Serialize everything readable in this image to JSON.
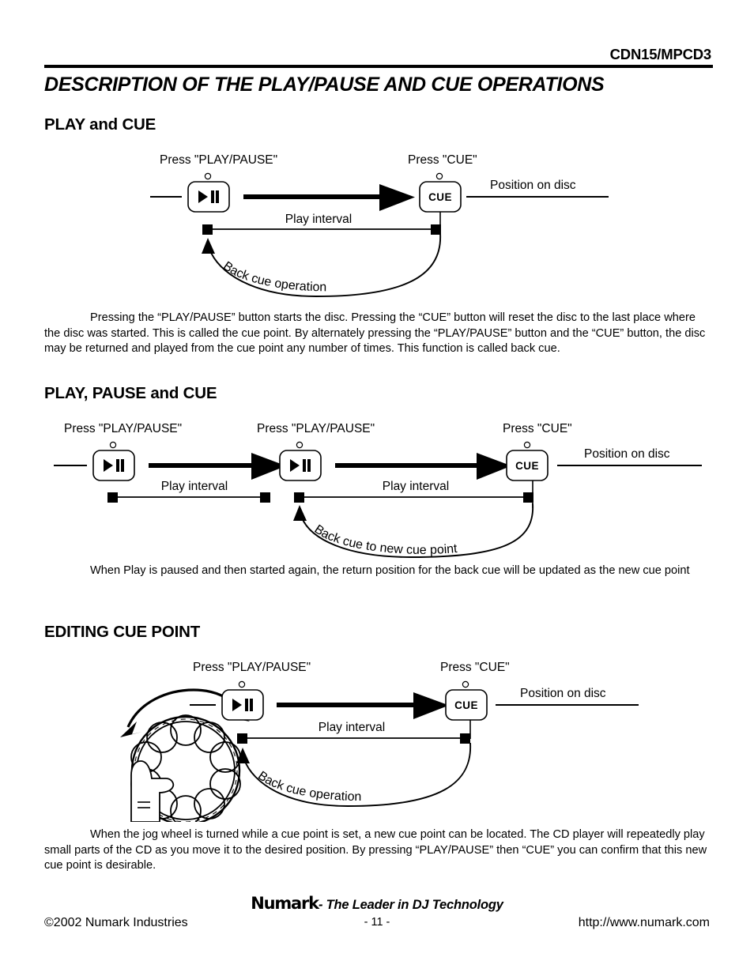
{
  "header": {
    "model": "CDN15/MPCD3"
  },
  "doc_title": "DESCRIPTION OF THE PLAY/PAUSE AND CUE OPERATIONS",
  "sections": [
    {
      "heading": "PLAY and CUE",
      "diagram": {
        "press_play_pause": "Press \"PLAY/PAUSE\"",
        "press_cue": "Press \"CUE\"",
        "position_on_disc": "Position on disc",
        "play_interval": "Play interval",
        "back_cue": "Back cue operation",
        "play_button_label": "▶❙❙",
        "cue_button_label": "CUE"
      },
      "paragraph": "Pressing the “PLAY/PAUSE” button starts the disc. Pressing the “CUE” button will reset the disc to the last place where the disc was started.   This is called the cue point.  By alternately pressing the “PLAY/PAUSE” button and the “CUE” button, the disc may be returned and played from the cue point any number of times.  This function is called back cue."
    },
    {
      "heading": "PLAY, PAUSE and CUE",
      "diagram": {
        "press_play_pause_1": "Press \"PLAY/PAUSE\"",
        "press_play_pause_2": "Press \"PLAY/PAUSE\"",
        "press_cue": "Press \"CUE\"",
        "position_on_disc": "Position on disc",
        "play_interval_1": "Play interval",
        "play_interval_2": "Play interval",
        "back_cue": "Back cue to new cue point",
        "play_button_label": "▶❙❙",
        "cue_button_label": "CUE"
      },
      "paragraph": "When Play is paused and then started again, the return position for the back cue will be updated as the new cue point"
    },
    {
      "heading": "EDITING CUE POINT",
      "diagram": {
        "press_play_pause": "Press \"PLAY/PAUSE\"",
        "press_cue": "Press \"CUE\"",
        "position_on_disc": "Position on disc",
        "play_interval": "Play interval",
        "back_cue": "Back cue operation",
        "play_button_label": "▶❙❙",
        "cue_button_label": "CUE",
        "jog_wheel": "jog-wheel"
      },
      "paragraph": "When the jog wheel is turned while a cue point is set, a new cue point can be located.   The CD player will repeatedly play small parts of the CD as you move it to the desired position.  By pressing “PLAY/PAUSE” then “CUE” you can confirm that this new cue point is desirable."
    }
  ],
  "footer": {
    "brand": "Numark",
    "tagline": "- The Leader in DJ Technology",
    "copyright": "©2002 Numark Industries",
    "page_number": "- 11 -",
    "url": "http://www.numark.com"
  },
  "colors": {
    "ink": "#000000",
    "paper": "#ffffff"
  }
}
